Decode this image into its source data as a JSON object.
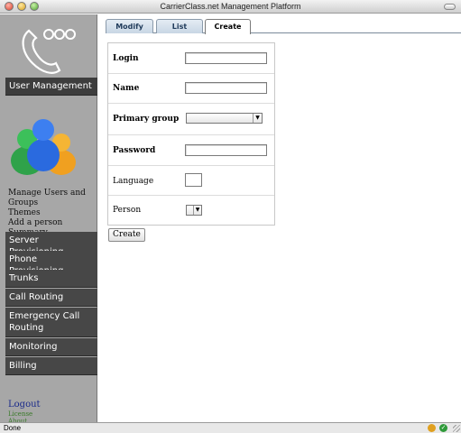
{
  "window": {
    "title": "CarrierClass.net Management Platform"
  },
  "sidebar": {
    "active_section": "User Management",
    "sublinks": [
      "Manage Users and Groups",
      "Themes",
      "Add a person",
      "Summary"
    ],
    "sections": [
      "Server Provisioning",
      "Phone Provisioning",
      "Trunks",
      "Call Routing",
      "Emergency Call Routing",
      "Monitoring",
      "Billing"
    ],
    "logout": "Logout",
    "license": "License",
    "about": "About"
  },
  "tabs": [
    "Modify",
    "List",
    "Create"
  ],
  "active_tab": "Create",
  "form": {
    "login_label": "Login",
    "login_value": "",
    "name_label": "Name",
    "name_value": "",
    "primary_group_label": "Primary group",
    "primary_group_value": "",
    "password_label": "Password",
    "password_value": "",
    "language_label": "Language",
    "language_value": "",
    "person_label": "Person",
    "person_value": "",
    "submit_label": "Create"
  },
  "statusbar": {
    "text": "Done"
  },
  "icons": {
    "logo": "phone-handset-logo",
    "people": "users-group-icon",
    "status_warning": "warning-icon",
    "status_ok": "checkmark-icon"
  },
  "colors": {
    "sidebar_bg": "#a7a7a7",
    "menu_item_bg": "#474747",
    "tab_text": "#1f3a5a",
    "link_green": "#3a7a2a",
    "logout_blue": "#1a2a8a"
  }
}
